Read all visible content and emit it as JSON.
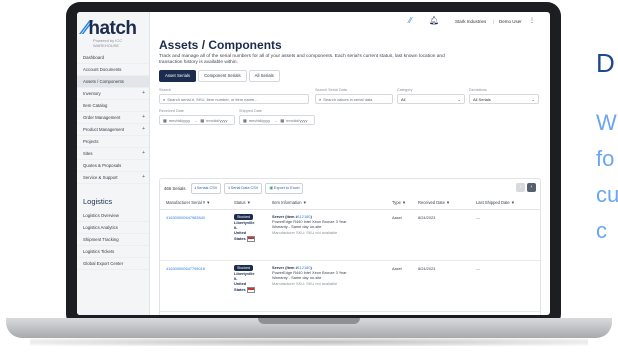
{
  "side": {
    "letter": "D",
    "lines": [
      "W",
      "fo",
      "cu",
      "c"
    ]
  },
  "sidebar": {
    "logo": "hatch",
    "logo_sub": "Powered by ICC WAREHOUSE",
    "items": [
      {
        "label": "Dashboard",
        "plus": false,
        "active": false
      },
      {
        "label": "Account Documents",
        "plus": false,
        "active": false
      },
      {
        "label": "Assets / Components",
        "plus": false,
        "active": true
      },
      {
        "label": "Inventory",
        "plus": true,
        "active": false
      },
      {
        "label": "Item Catalog",
        "plus": false,
        "active": false
      },
      {
        "label": "Order Management",
        "plus": true,
        "active": false
      },
      {
        "label": "Product Management",
        "plus": true,
        "active": false
      },
      {
        "label": "Projects",
        "plus": false,
        "active": false
      },
      {
        "label": "Sites",
        "plus": true,
        "active": false
      },
      {
        "label": "Quotes & Proposals",
        "plus": false,
        "active": false
      },
      {
        "label": "Service & Support",
        "plus": true,
        "active": false
      }
    ],
    "section": "Logistics",
    "section_items": [
      {
        "label": "Logistics Overview"
      },
      {
        "label": "Logistics Analytics"
      },
      {
        "label": "Shipment Tracking"
      },
      {
        "label": "Logistics Tickets"
      },
      {
        "label": "Global Export Center"
      }
    ]
  },
  "topbar": {
    "company": "Stark Industries",
    "separator": "|",
    "user": "Demo User",
    "menu": "⋮"
  },
  "page": {
    "title": "Assets / Components",
    "description": "Track and manage all of the serial numbers for all of your assets and components. Each serial's current status, last known location and transaction history is available within."
  },
  "tabs": [
    {
      "label": "Asset Serials",
      "active": true
    },
    {
      "label": "Component Serials",
      "active": false
    },
    {
      "label": "All Serials",
      "active": false
    }
  ],
  "filters": {
    "search_label": "Search",
    "search_placeholder": "Search serial #, SKU, item number, or item name...",
    "serial_label": "Search Serial Data",
    "serial_placeholder": "Search values in serial data",
    "category_label": "Category",
    "category_value": "All",
    "deviations_label": "Deviations",
    "deviations_value": "All Serials",
    "received_label": "Received Date",
    "shipped_label": "Shipped Date",
    "date_placeholder": "mm/dd/yyyy",
    "date_sep": "→"
  },
  "results": {
    "count": "466 Serials",
    "buttons": [
      "Serials CSV",
      "Serial Data CSV",
      "Export to Excel"
    ],
    "prev": "‹",
    "next": "›",
    "columns": [
      "Manufacturer Serial # ▼",
      "Status ▼",
      "Item Information ▼",
      "Type ▼",
      "Received Date ▼",
      "Last Shipped Date ▼"
    ],
    "rows": [
      {
        "serial": "416300000647983840",
        "status": "Stocked",
        "loc1": "Libertyville",
        "loc2": "IL",
        "loc3": "United",
        "loc4": "States",
        "item_prefix": "Server (Item #",
        "item_num": "112180",
        "item_suffix": ")",
        "item_desc1": "PowerEdge R440 Intel Xeon Bronze 3 Year",
        "item_desc2": "Warranty - Same day on-site",
        "sku_label": "Manufacturer SKU:",
        "sku_value": "SKU not available",
        "type": "Asset",
        "received": "8/24/2023",
        "shipped": "---"
      },
      {
        "serial": "416300000647795018",
        "status": "Stocked",
        "loc1": "Libertyville",
        "loc2": "IL",
        "loc3": "United",
        "loc4": "States",
        "item_prefix": "Server (Item #",
        "item_num": "112180",
        "item_suffix": ")",
        "item_desc1": "PowerEdge R440 Intel Xeon Bronze 3 Year",
        "item_desc2": "Warranty - Same day on-site",
        "sku_label": "Manufacturer SKU:",
        "sku_value": "SKU not available",
        "type": "Asset",
        "received": "8/24/2023",
        "shipped": "---"
      }
    ]
  }
}
